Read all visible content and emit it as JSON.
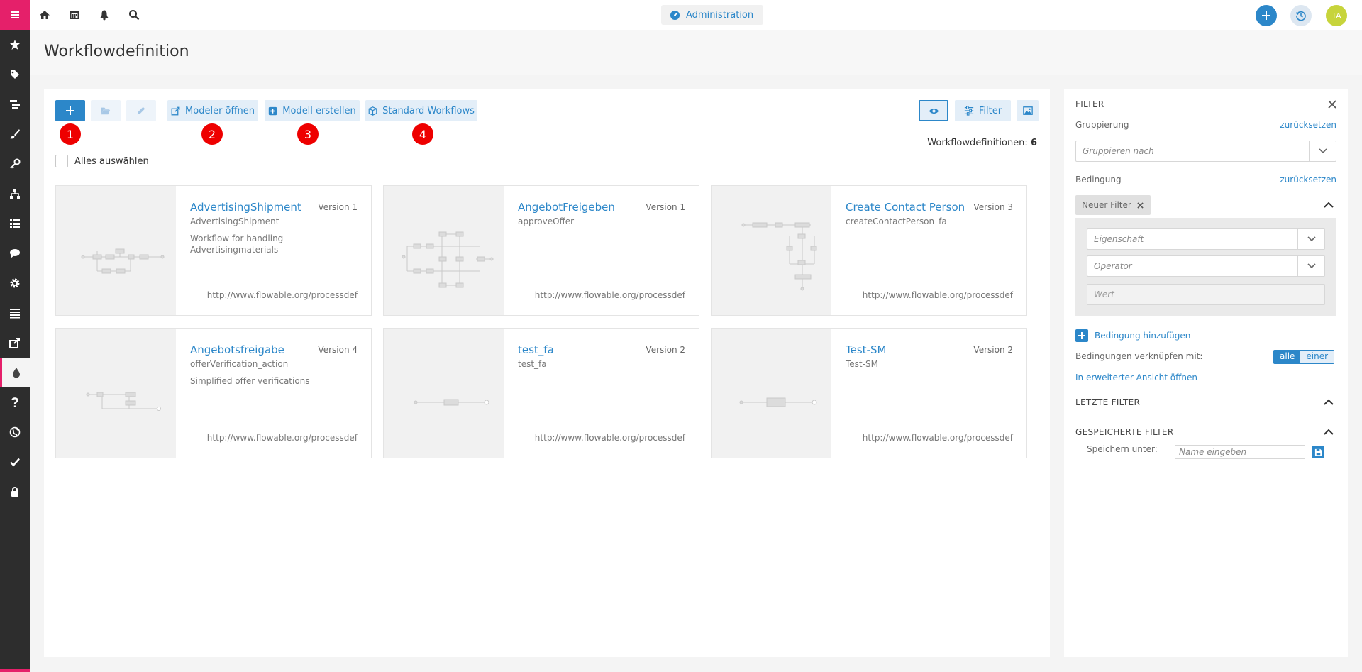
{
  "topbar": {
    "admin_label": "Administration",
    "avatar_initials": "TA"
  },
  "page": {
    "title": "Workflowdefinition"
  },
  "toolbar": {
    "modeler_open_label": "Modeler öffnen",
    "create_model_label": "Modell erstellen",
    "standard_workflows_label": "Standard Workflows",
    "filter_label": "Filter",
    "badges": [
      "1",
      "2",
      "3",
      "4"
    ]
  },
  "list": {
    "count_label": "Workflowdefinitionen:",
    "count_value": "6",
    "select_all_label": "Alles auswählen",
    "cards": [
      {
        "name": "AdvertisingShipment",
        "version": "Version 1",
        "key": "AdvertisingShipment",
        "description": "Workflow for handling Advertisingmaterials",
        "namespace": "http://www.flowable.org/processdef"
      },
      {
        "name": "AngebotFreigeben",
        "version": "Version 1",
        "key": "approveOffer",
        "description": "",
        "namespace": "http://www.flowable.org/processdef"
      },
      {
        "name": "Create Contact Person",
        "version": "Version 3",
        "key": "createContactPerson_fa",
        "description": "",
        "namespace": "http://www.flowable.org/processdef"
      },
      {
        "name": "Angebotsfreigabe",
        "version": "Version 4",
        "key": "offerVerification_action",
        "description": "Simplified offer verifications",
        "namespace": "http://www.flowable.org/processdef"
      },
      {
        "name": "test_fa",
        "version": "Version 2",
        "key": "test_fa",
        "description": "",
        "namespace": "http://www.flowable.org/processdef"
      },
      {
        "name": "Test-SM",
        "version": "Version 2",
        "key": "Test-SM",
        "description": "",
        "namespace": "http://www.flowable.org/processdef"
      }
    ]
  },
  "filter_panel": {
    "title": "FILTER",
    "grouping_label": "Gruppierung",
    "reset_label": "zurücksetzen",
    "group_by_placeholder": "Gruppieren nach",
    "condition_label": "Bedingung",
    "new_filter_chip": "Neuer Filter",
    "property_placeholder": "Eigenschaft",
    "operator_placeholder": "Operator",
    "value_placeholder": "Wert",
    "add_condition_label": "Bedingung hinzufügen",
    "link_conditions_label": "Bedingungen verknüpfen mit:",
    "link_all": "alle",
    "link_one": "einer",
    "extended_view_label": "In erweiterter Ansicht öffnen",
    "last_filters_label": "LETZTE FILTER",
    "saved_filters_label": "GESPEICHERTE FILTER",
    "save_under_label": "Speichern unter:",
    "name_placeholder": "Name eingeben"
  },
  "colors": {
    "accent": "#2c87c9",
    "brand": "#e5206a",
    "sidebar": "#2d2d2d",
    "badge": "#ee0000"
  },
  "sidebar_icons": [
    "star-icon",
    "tag-icon",
    "list-alt-icon",
    "brush-icon",
    "key-icon",
    "sitemap-icon",
    "list-icon",
    "comment-icon",
    "gear-icon",
    "table-list-icon",
    "share-icon",
    "drop-icon",
    "question-icon",
    "globe-icon",
    "check-icon",
    "lock-icon"
  ]
}
